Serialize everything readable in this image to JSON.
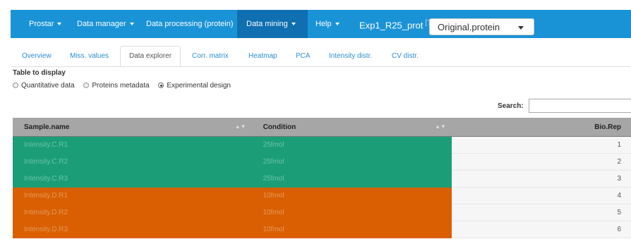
{
  "navbar": {
    "items": [
      {
        "label": "Prostar"
      },
      {
        "label": "Data manager"
      },
      {
        "label": "Data processing (protein)"
      },
      {
        "label": "Data mining"
      },
      {
        "label": "Help"
      }
    ],
    "dataset_name": "Exp1_R25_prot",
    "help_marker": "[?]",
    "select_value": "Original.protein",
    "color": "#1a93d6",
    "active_color": "#0f6fb0"
  },
  "tabs": [
    {
      "label": "Overview"
    },
    {
      "label": "Miss. values"
    },
    {
      "label": "Data explorer"
    },
    {
      "label": "Corr. matrix"
    },
    {
      "label": "Heatmap"
    },
    {
      "label": "PCA"
    },
    {
      "label": "Intensity distr."
    },
    {
      "label": "CV distr."
    }
  ],
  "table_display": {
    "title": "Table to display",
    "options": [
      {
        "label": "Quantitative data",
        "checked": false
      },
      {
        "label": "Proteins metadata",
        "checked": false
      },
      {
        "label": "Experimental design",
        "checked": true
      }
    ]
  },
  "search": {
    "label": "Search:",
    "value": ""
  },
  "table": {
    "headers": [
      "Sample.name",
      "Condition",
      "Bio.Rep"
    ],
    "rows": [
      {
        "sample": "Intensity.C.R1",
        "condition": "25fmol",
        "biorep": "1",
        "color": "#1b9e77"
      },
      {
        "sample": "Intensity.C.R2",
        "condition": "25fmol",
        "biorep": "2",
        "color": "#1b9e77"
      },
      {
        "sample": "Intensity.C.R3",
        "condition": "25fmol",
        "biorep": "3",
        "color": "#1b9e77"
      },
      {
        "sample": "Intensity.D.R1",
        "condition": "10fmol",
        "biorep": "4",
        "color": "#d95f02"
      },
      {
        "sample": "Intensity.D.R2",
        "condition": "10fmol",
        "biorep": "5",
        "color": "#d95f02"
      },
      {
        "sample": "Intensity.D.R3",
        "condition": "10fmol",
        "biorep": "6",
        "color": "#d95f02"
      }
    ]
  }
}
